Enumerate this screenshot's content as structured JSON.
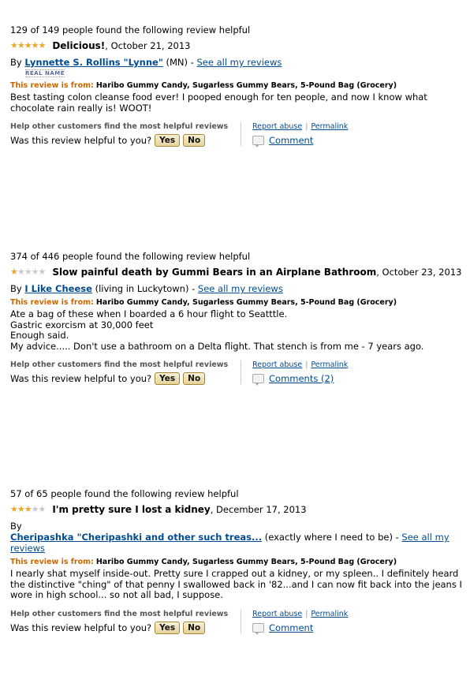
{
  "colors": {
    "link": "#004b91",
    "star": "#e8a72a",
    "from_label": "#cc6600",
    "button": "#e4d29a"
  },
  "labels": {
    "by": "By",
    "see_all": "See all my reviews",
    "from": "This review is from:",
    "help_others": "Help other customers find the most helpful reviews",
    "was_helpful": "Was this review helpful to you?",
    "yes": "Yes",
    "no": "No",
    "report_abuse": "Report abuse",
    "permalink": "Permalink",
    "real_name": "REAL NAME"
  },
  "product": "Haribo Gummy Candy, Sugarless Gummy Bears, 5-Pound Bag (Grocery)",
  "reviews": [
    {
      "helpful": "129 of 149 people found the following review helpful",
      "rating": 5,
      "title": "Delicious!",
      "date": ", October 21, 2013",
      "author": "Lynnette S. Rollins \"Lynne\"",
      "location": " (MN) - ",
      "real_name": true,
      "body": "Best tasting colon cleanse food ever! I pooped enough for ten people, and now I know what chocolate rain really is! WOOT!",
      "comments": "Comment"
    },
    {
      "helpful": "374 of 446 people found the following review helpful",
      "rating": 1,
      "title": "Slow painful death by Gummi Bears in an Airplane Bathroom",
      "date": ", October 23, 2013",
      "author": "I Like Cheese",
      "location": " (living in Luckytown) - ",
      "real_name": false,
      "body": "Ate a bag of these when I boarded a 6 hour flight to Seatttle.\nGastric exorcism at 30,000 feet\nEnough said.\nMy advice..... Don't use a bathroom on a Delta flight. That stench is from me - 7 years ago.",
      "comments": "Comments (2)"
    },
    {
      "helpful": "57 of 65 people found the following review helpful",
      "rating": 3,
      "title": "I'm pretty sure I lost a kidney",
      "date": ", December 17, 2013",
      "author": "Cheripashka \"Cheripashki and other such treas...",
      "location": " (exactly where I need to be) - ",
      "real_name": false,
      "body": "I nearly shat myself inside-out. Pretty sure I crapped out a kidney, or my spleen.. I definitely heard the distinctive \"ching\" of that penny I swallowed back in '82...and I can now fit back into the jeans I wore in high school... so not all bad, I suppose.",
      "comments": "Comment"
    }
  ]
}
